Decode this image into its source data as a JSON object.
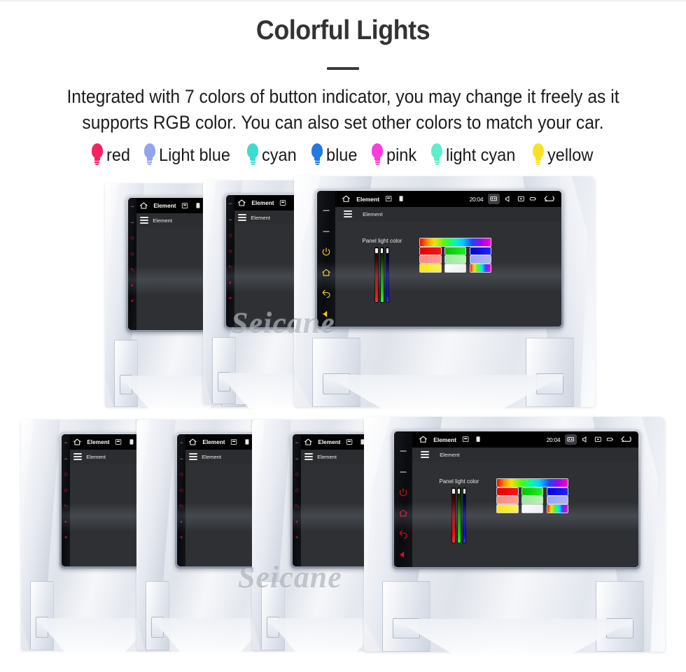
{
  "header": {
    "title": "Colorful Lights",
    "subtitle": "Integrated with 7 colors of button indicator, you may change it freely as it supports RGB color. You can also set other colors to match your car."
  },
  "legend": {
    "items": [
      {
        "label": "red",
        "color": "#f5245f"
      },
      {
        "label": "Light blue",
        "color": "#92a6ef"
      },
      {
        "label": "cyan",
        "color": "#3fdbd0"
      },
      {
        "label": "blue",
        "color": "#2478e0"
      },
      {
        "label": "pink",
        "color": "#fa3ce0"
      },
      {
        "label": "light cyan",
        "color": "#5eeecb"
      },
      {
        "label": "yellow",
        "color": "#f7e126"
      }
    ]
  },
  "watermark": {
    "text": "Seicane"
  },
  "device": {
    "statusbar": {
      "title": "Element",
      "time": "20:04",
      "icons": [
        "home-icon",
        "sd-card-icon",
        "usb-drive-icon"
      ],
      "right_icons": [
        "screen-mode-icon",
        "volume-icon",
        "screenshot-icon",
        "recent-apps-icon",
        "back-icon"
      ]
    },
    "appbar": {
      "title": "Element",
      "menu_icon": "hamburger-menu-icon"
    },
    "panel": {
      "label": "Panel light color",
      "sliders": [
        {
          "name": "red-channel-slider",
          "color": "#ff1111",
          "value": 96
        },
        {
          "name": "green-channel-slider",
          "color": "#14e014",
          "value": 96
        },
        {
          "name": "blue-channel-slider",
          "color": "#1111ff",
          "value": 96
        }
      ],
      "swatch_rows": [
        [
          "rainbow"
        ],
        [
          "red",
          "green",
          "blue"
        ],
        [
          "salmon",
          "light-green",
          "periwinkle"
        ],
        [
          "yellow",
          "white",
          "rainbow"
        ]
      ]
    },
    "bezel_buttons": [
      "seek-prev",
      "seek-next",
      "power",
      "home",
      "back",
      "volume-down",
      "volume-up"
    ]
  },
  "units": {
    "top_row": [
      {
        "name": "radio-unit-top-1",
        "led": "#d40c1e",
        "state": "idle"
      },
      {
        "name": "radio-unit-top-2",
        "led": "#d40c1e",
        "state": "idle"
      },
      {
        "name": "radio-unit-top-3",
        "led": "#e8c81e",
        "state": "color-picker"
      }
    ],
    "bottom_row": [
      {
        "name": "radio-unit-bottom-1",
        "led": "#d40c1e",
        "state": "partial"
      },
      {
        "name": "radio-unit-bottom-2",
        "led": "#d40c1e",
        "state": "partial"
      },
      {
        "name": "radio-unit-bottom-3",
        "led": "#d40c1e",
        "state": "partial"
      },
      {
        "name": "radio-unit-bottom-4",
        "led": "#d40c1e",
        "state": "color-picker"
      }
    ]
  }
}
